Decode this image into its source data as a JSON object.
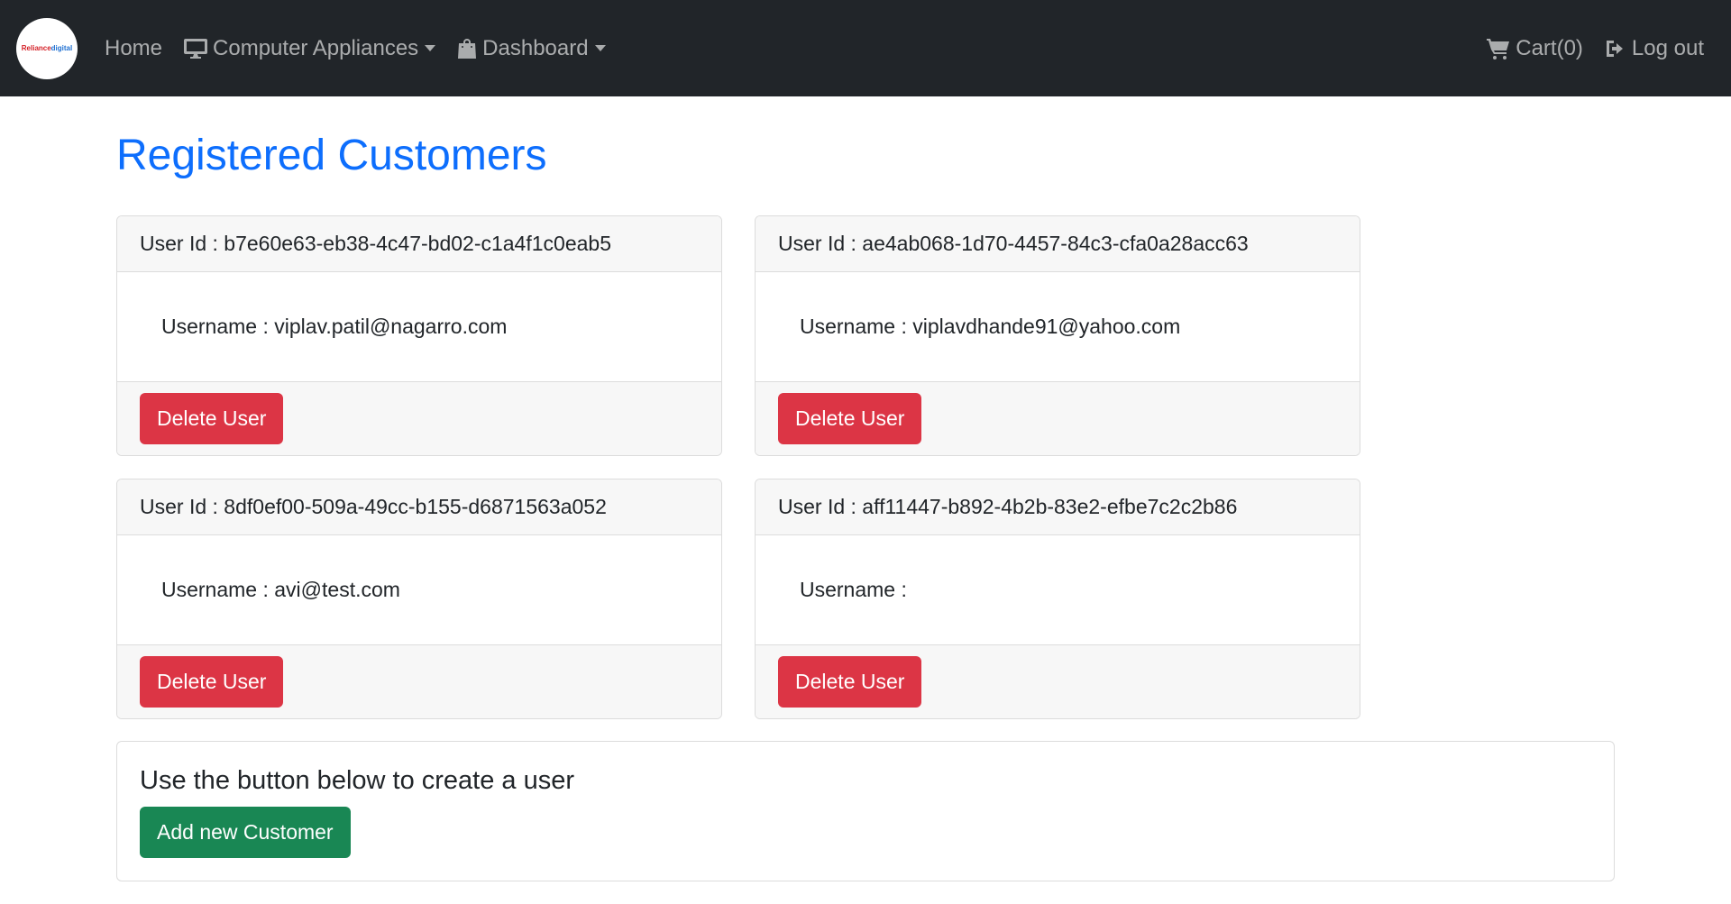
{
  "navbar": {
    "logo_text_red": "Reliance",
    "logo_text_blue": "digital",
    "home": "Home",
    "computer_appliances": "Computer Appliances",
    "dashboard": "Dashboard",
    "cart": "Cart(0)",
    "logout": "Log out"
  },
  "page": {
    "title": "Registered Customers"
  },
  "customers": [
    {
      "user_id": "User Id : b7e60e63-eb38-4c47-bd02-c1a4f1c0eab5",
      "username": "Username : viplav.patil@nagarro.com",
      "delete_label": "Delete User"
    },
    {
      "user_id": "User Id : ae4ab068-1d70-4457-84c3-cfa0a28acc63",
      "username": "Username : viplavdhande91@yahoo.com",
      "delete_label": "Delete User"
    },
    {
      "user_id": "User Id : 8df0ef00-509a-49cc-b155-d6871563a052",
      "username": "Username : avi@test.com",
      "delete_label": "Delete User"
    },
    {
      "user_id": "User Id : aff11447-b892-4b2b-83e2-efbe7c2c2b86",
      "username": "Username :",
      "delete_label": "Delete User"
    }
  ],
  "create": {
    "title": "Use the button below to create a user",
    "button_label": "Add new Customer"
  },
  "colors": {
    "navbar_bg": "#212529",
    "title_blue": "#0d6efd",
    "danger": "#dc3545",
    "success": "#198754"
  },
  "icons": {
    "computer": "desktop-icon",
    "dashboard": "shopping-bag-icon",
    "cart": "cart-icon",
    "logout": "logout-icon"
  }
}
